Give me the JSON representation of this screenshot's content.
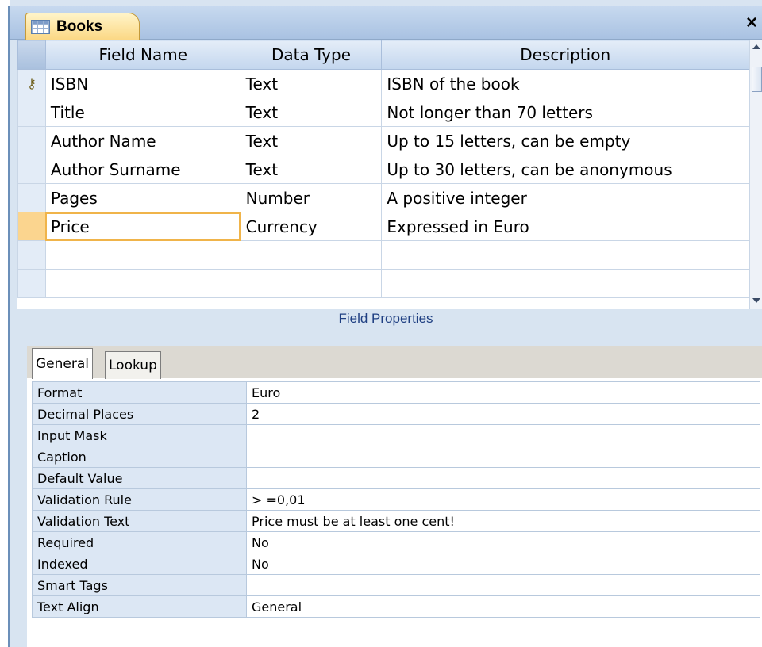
{
  "window": {
    "tab_title": "Books",
    "close_glyph": "×",
    "tab_icon": "table-icon"
  },
  "design_grid": {
    "headers": {
      "field_name": "Field Name",
      "data_type": "Data Type",
      "description": "Description"
    },
    "rows": [
      {
        "field_name": "ISBN",
        "data_type": "Text",
        "description": "ISBN of the book",
        "primary_key": true
      },
      {
        "field_name": "Title",
        "data_type": "Text",
        "description": "Not longer than 70 letters"
      },
      {
        "field_name": "Author Name",
        "data_type": "Text",
        "description": "Up to 15 letters, can be empty"
      },
      {
        "field_name": "Author Surname",
        "data_type": "Text",
        "description": "Up to 30 letters, can be anonymous"
      },
      {
        "field_name": "Pages",
        "data_type": "Number",
        "description": "A positive integer"
      },
      {
        "field_name": "Price",
        "data_type": "Currency",
        "description": "Expressed in Euro",
        "current": true
      },
      {
        "field_name": "",
        "data_type": "",
        "description": ""
      },
      {
        "field_name": "",
        "data_type": "",
        "description": ""
      }
    ]
  },
  "field_properties": {
    "title": "Field Properties",
    "tabs": {
      "general": "General",
      "lookup": "Lookup"
    },
    "rows": [
      {
        "name": "Format",
        "value": "Euro"
      },
      {
        "name": "Decimal Places",
        "value": "2"
      },
      {
        "name": "Input Mask",
        "value": ""
      },
      {
        "name": "Caption",
        "value": ""
      },
      {
        "name": "Default Value",
        "value": ""
      },
      {
        "name": "Validation Rule",
        "value": "> =0,01"
      },
      {
        "name": "Validation Text",
        "value": "Price must be at least one cent!"
      },
      {
        "name": "Required",
        "value": "No"
      },
      {
        "name": "Indexed",
        "value": "No"
      },
      {
        "name": "Smart Tags",
        "value": ""
      },
      {
        "name": "Text Align",
        "value": "General"
      }
    ]
  }
}
